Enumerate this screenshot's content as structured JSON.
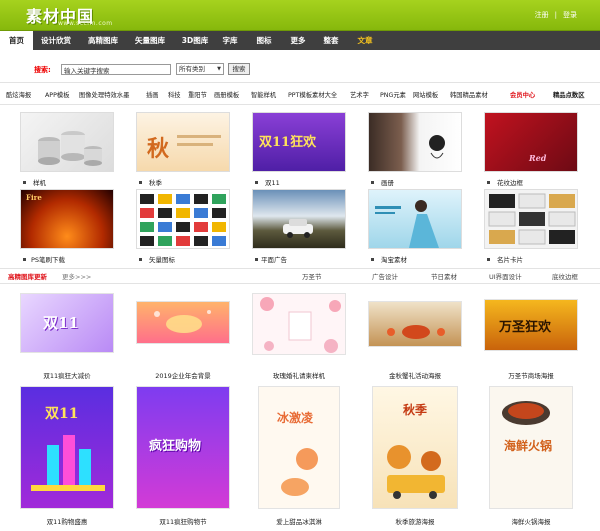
{
  "header": {
    "logo_text": "素材中国",
    "logo_url": "www.sccnn.com",
    "links": [
      "注册",
      "登录"
    ],
    "separator": "|"
  },
  "nav": {
    "items": [
      "首页",
      "设计欣赏",
      "高精图库",
      "矢量图库",
      "3D图库",
      "字库",
      "图标",
      "更多",
      "整套",
      "文章"
    ]
  },
  "search": {
    "label": "搜索:",
    "value": "输入关键字搜索",
    "category": "所有类别",
    "button": "搜索"
  },
  "categories": [
    "酷炫海报",
    "APP模板",
    "图像处理特效水墨",
    "插画",
    "科技",
    "重阳节",
    "画册模板",
    "智能样机",
    "PPT模板素材大全",
    "艺术字",
    "PNG元素",
    "网站模板",
    "韩国精品素材",
    "会员中心",
    "精品点数区"
  ],
  "thumbs": [
    {
      "label": "样机"
    },
    {
      "label": "秋季"
    },
    {
      "label": "双11"
    },
    {
      "label": "画册"
    },
    {
      "label": "花纹边框"
    },
    {
      "label": "PS笔刷下载"
    },
    {
      "label": "矢量图标"
    },
    {
      "label": "平面广告"
    },
    {
      "label": "淘宝素材"
    },
    {
      "label": "名片卡片"
    }
  ],
  "thumb_art": {
    "autumn": "秋",
    "double11": "双11狂欢",
    "fire": "Fire",
    "red": "Red"
  },
  "section": {
    "title": "高精图库更新",
    "more": "更多>>>",
    "tabs": [
      "万圣节",
      "广告设计",
      "节日素材",
      "UI界面设计",
      "底纹边框"
    ]
  },
  "cards": [
    {
      "label": "双11疯狂大减价"
    },
    {
      "label": "2019企业年会背景"
    },
    {
      "label": "玫瑰婚礼请柬样机"
    },
    {
      "label": "金秋蟹礼活动海报"
    },
    {
      "label": "万圣节商场海报"
    },
    {
      "label": "双11购物盛惠"
    },
    {
      "label": "双11疯狂购物节"
    },
    {
      "label": "爱上甜品冰淇淋"
    },
    {
      "label": "秋季旅游海报"
    },
    {
      "label": "海鲜火锅海报"
    }
  ],
  "card_art": {
    "double11": "双11",
    "halloween": "万圣狂欢",
    "shopping": "疯狂购物",
    "icecream": "冰激凌",
    "autumn": "秋季",
    "seafood": "海鲜火锅"
  },
  "colors": {
    "brand_green": "#8cc010",
    "nav_bg": "#3f3f3f",
    "accent_red": "#e0161d",
    "nav_accent": "#f4c21e"
  }
}
